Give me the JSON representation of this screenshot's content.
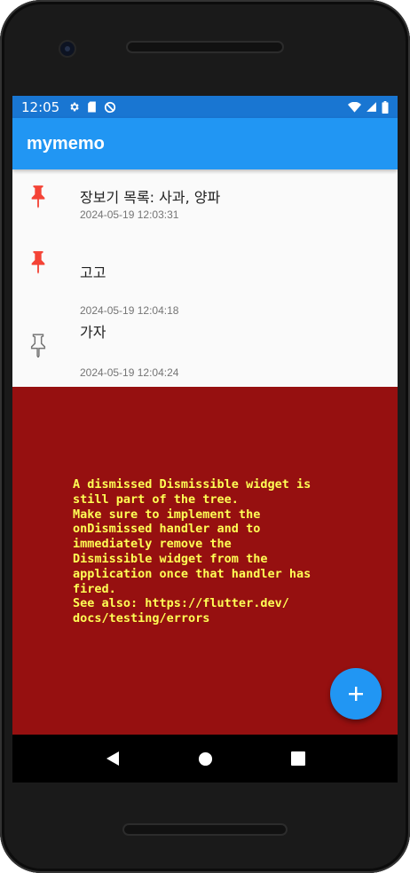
{
  "status_bar": {
    "time": "12:05",
    "icons_left": [
      "gear-icon",
      "sd-card-icon",
      "do-not-disturb-icon"
    ],
    "icons_right": [
      "wifi-icon",
      "signal-icon",
      "battery-icon"
    ]
  },
  "app_bar": {
    "title": "mymemo"
  },
  "memos": [
    {
      "text": "장보기 목록: 사과, 양파",
      "date": "2024-05-19 12:03:31",
      "pinned": true
    },
    {
      "text": "고고",
      "date": "2024-05-19 12:04:18",
      "pinned": true
    },
    {
      "text": "가자",
      "date": "2024-05-19 12:04:24",
      "pinned": false
    }
  ],
  "error": {
    "message": "A dismissed Dismissible widget is\nstill part of the tree.\nMake sure to implement the\nonDismissed handler and to\nimmediately remove the\nDismissible widget from the\napplication once that handler has\nfired.\nSee also: https://flutter.dev/\ndocs/testing/errors"
  },
  "fab": {
    "icon": "plus-icon"
  },
  "nav": {
    "icons": [
      "back-icon",
      "home-icon",
      "recents-icon"
    ]
  },
  "colors": {
    "app_bar": "#2196f3",
    "status_bar": "#1976d2",
    "pin_active": "#f44336",
    "pin_inactive": "#757575",
    "error_background": "#961010",
    "error_text": "#ffff55"
  }
}
